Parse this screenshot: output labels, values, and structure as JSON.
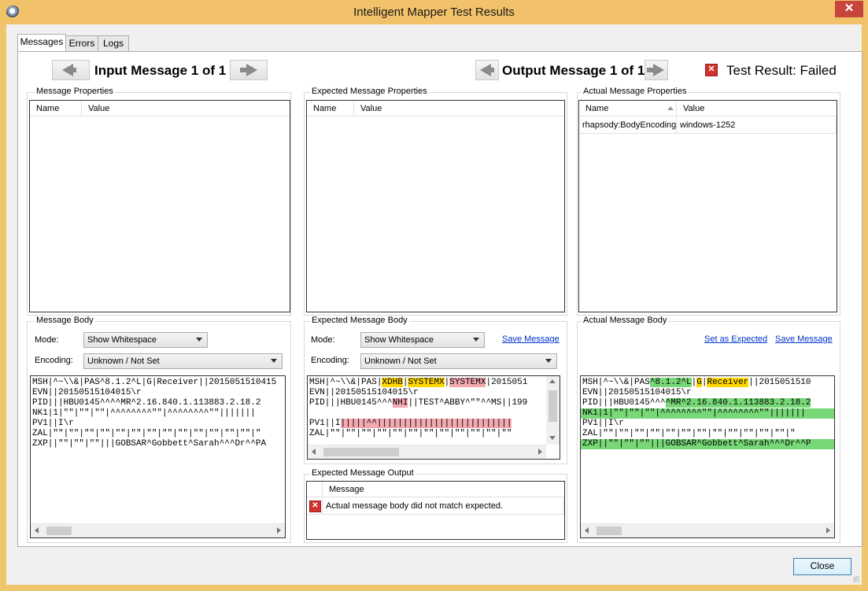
{
  "window": {
    "title": "Intelligent Mapper Test Results",
    "close_glyph": "✕"
  },
  "tabs": [
    {
      "label": "Messages"
    },
    {
      "label": "Errors"
    },
    {
      "label": "Logs"
    }
  ],
  "nav": {
    "input_label": "Input Message 1 of 1",
    "output_label": "Output Message 1 of 1",
    "result_label": "Test Result: Failed",
    "result_icon_glyph": "✕"
  },
  "panels": {
    "message_properties": {
      "title": "Message Properties",
      "col_name": "Name",
      "col_value": "Value"
    },
    "expected_properties": {
      "title": "Expected Message Properties",
      "col_name": "Name",
      "col_value": "Value"
    },
    "actual_properties": {
      "title": "Actual Message Properties",
      "col_name": "Name",
      "col_value": "Value",
      "rows": [
        {
          "name": "rhapsody:BodyEncoding",
          "value": "windows-1252"
        }
      ]
    }
  },
  "bodies": {
    "input": {
      "title": "Message Body",
      "mode_label": "Mode:",
      "mode_value": "Show Whitespace",
      "encoding_label": "Encoding:",
      "encoding_value": "Unknown / Not Set",
      "lines": [
        "MSH|^~\\\\&|PAS^8.1.2^L|G|Receiver||2015051510415",
        "EVN||20150515104015\\r",
        "PID|||HBU0145^^^^MR^2.16.840.1.113883.2.18.2",
        "NK1|1|\"\"|\"\"|\"\"|^^^^^^^^\"\"|^^^^^^^^\"\"|||||||",
        "PV1||I\\r",
        "ZAL|\"\"|\"\"|\"\"|\"\"|\"\"|\"\"|\"\"|\"\"|\"\"|\"\"|\"\"|\"\"|\"\"|\"",
        "ZXP||\"\"|\"\"|\"\"|||GOBSAR^Gobbett^Sarah^^^Dr^^PA"
      ]
    },
    "expected": {
      "title": "Expected Message Body",
      "mode_label": "Mode:",
      "mode_value": "Show Whitespace",
      "encoding_label": "Encoding:",
      "encoding_value": "Unknown / Not Set",
      "save_link": "Save Message",
      "line1_a": "MSH|^~\\\\&|PAS|",
      "line1_b": "XDHB",
      "line1_c": "|",
      "line1_d": "SYSTEMX",
      "line1_e": "|",
      "line1_f": "SYSTEMX",
      "line1_g": "|2015051",
      "line2": "EVN||20150515104015\\r",
      "line3_a": "PID|||HBU0145^^^",
      "line3_b": "NHI",
      "line3_c": "||TEST^ABBY^\"\"^^MS||199",
      "line4": "",
      "line5_a": "PV1||I",
      "line5_b": "|||||^^||||||||||||||||||||||||||",
      "line6": "ZAL|\"\"|\"\"|\"\"|\"\"|\"\"|\"\"|\"\"|\"\"|\"\"|\"\"|\"\"|\"\""
    },
    "actual": {
      "title": "Actual Message Body",
      "set_expected_link": "Set as Expected",
      "save_link": "Save Message",
      "line1_a": "MSH|^~\\\\&|PAS",
      "line1_b": "^8.1.2^L",
      "line1_c": "|",
      "line1_d": "G",
      "line1_e": "|",
      "line1_f": "Receiver",
      "line1_g": "||2015051510",
      "line2": "EVN||20150515104015\\r",
      "line3_a": "PID|||HBU0145^^^",
      "line3_b": "^MR^2.16.840.1.113883.2.18.2",
      "line4": "NK1|1|\"\"|\"\"|\"\"|^^^^^^^^\"\"|^^^^^^^^\"\"|||||||",
      "line5": "PV1||I\\r",
      "line6": "ZAL|\"\"|\"\"|\"\"|\"\"|\"\"|\"\"|\"\"|\"\"|\"\"|\"\"|\"\"|\"\"|\"",
      "line7": "ZXP||\"\"|\"\"|\"\"|||GOBSAR^Gobbett^Sarah^^^Dr^^P"
    }
  },
  "output": {
    "title": "Expected Message Output",
    "col_message": "Message",
    "rows": [
      {
        "message": "Actual message body did not match expected.",
        "icon_glyph": "✕"
      }
    ]
  },
  "footer": {
    "close_label": "Close"
  },
  "colors": {
    "titlebar": "#f2c26a",
    "close": "#c7453b",
    "highlight_yellow": "#ffd700",
    "highlight_pink": "#f4a9b0",
    "highlight_green": "#78d878",
    "link": "#0033cc"
  }
}
